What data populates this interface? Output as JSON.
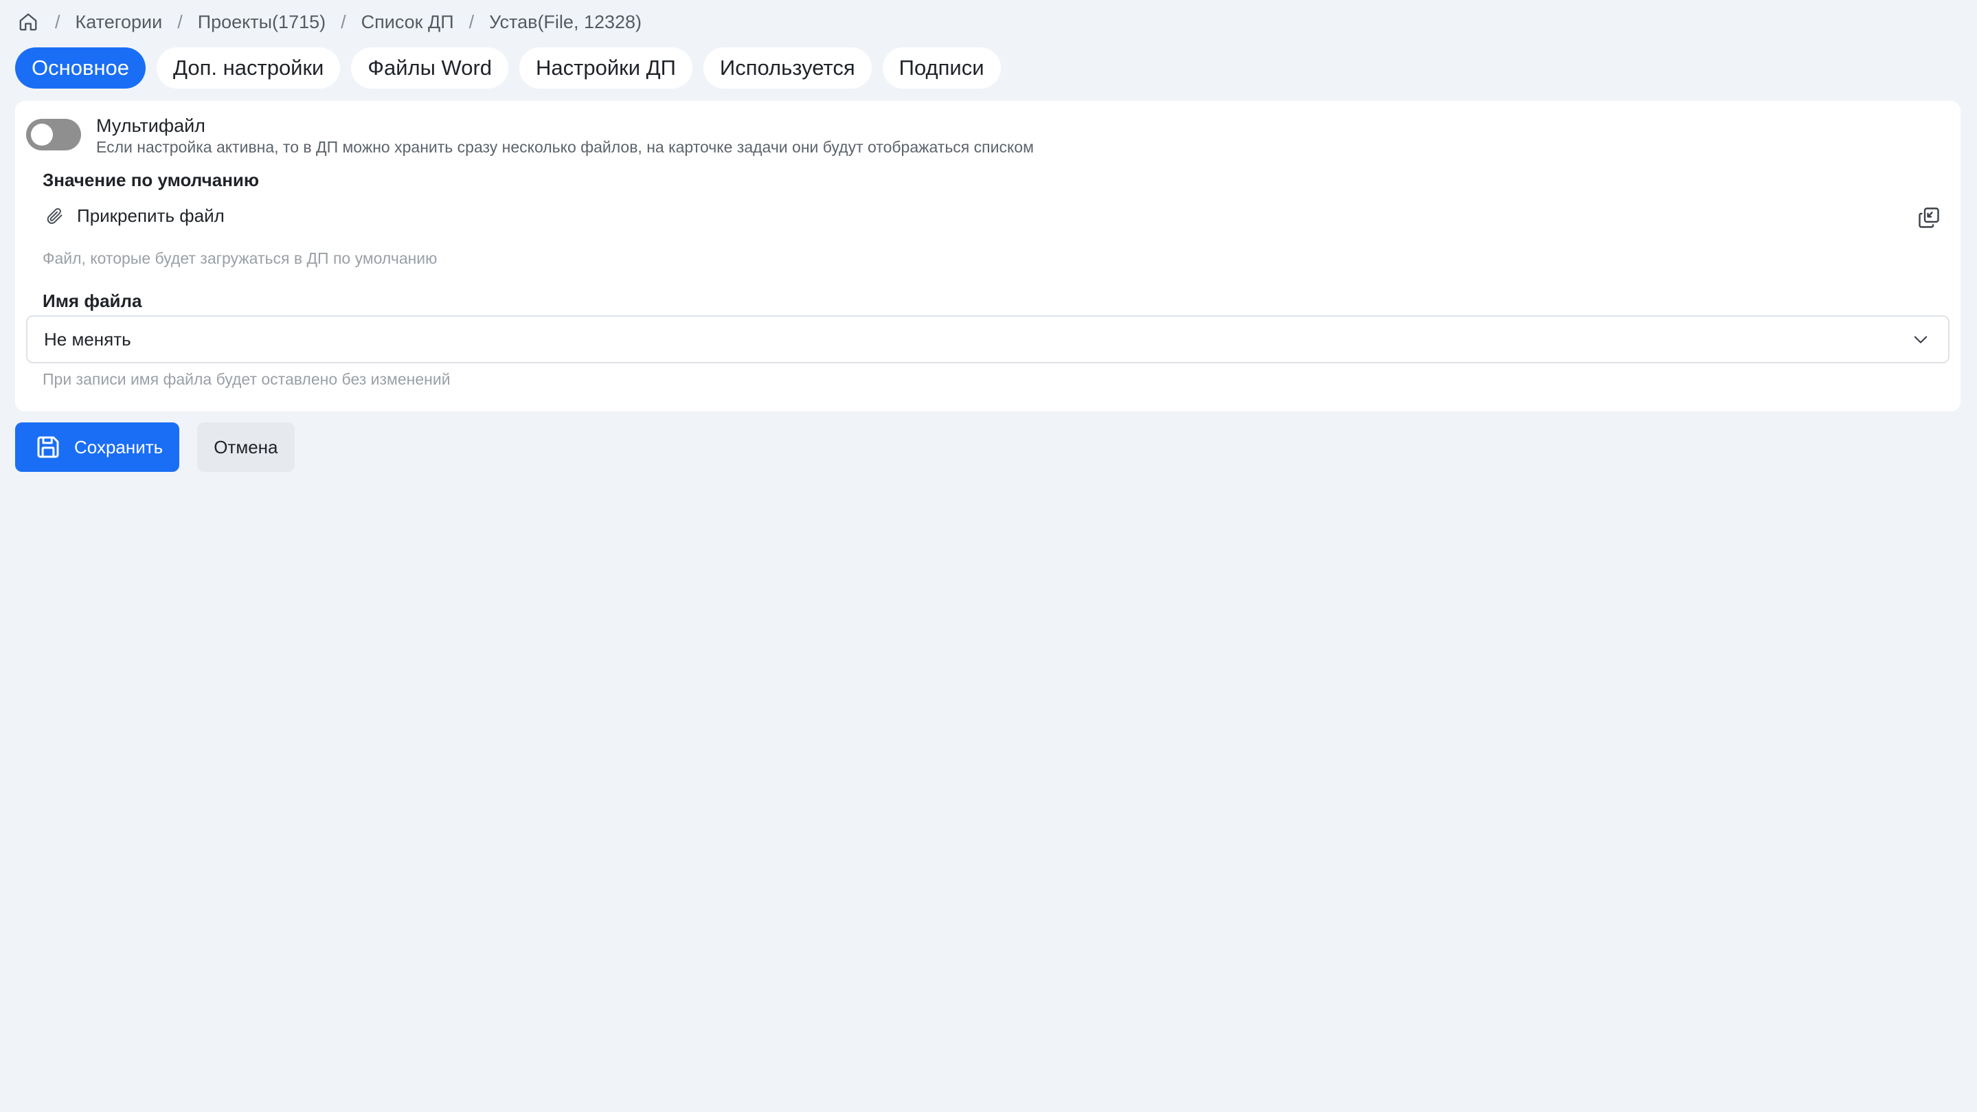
{
  "breadcrumb": {
    "home_icon": "home-icon",
    "items": [
      "Категории",
      "Проекты(1715)",
      "Список ДП",
      "Устав(File, 12328)"
    ],
    "separator": "/"
  },
  "tabs": [
    {
      "label": "Основное",
      "active": true
    },
    {
      "label": "Доп. настройки",
      "active": false
    },
    {
      "label": "Файлы Word",
      "active": false
    },
    {
      "label": "Настройки ДП",
      "active": false
    },
    {
      "label": "Используется",
      "active": false
    },
    {
      "label": "Подписи",
      "active": false
    }
  ],
  "multifile": {
    "title": "Мультифайл",
    "description": "Если настройка активна, то в ДП можно хранить сразу несколько файлов, на карточке задачи они будут отображаться списком",
    "enabled": false
  },
  "default_value": {
    "label": "Значение по умолчанию",
    "attach_label": "Прикрепить файл",
    "hint": "Файл, которые будет загружаться в ДП по умолчанию"
  },
  "file_name": {
    "label": "Имя файла",
    "value": "Не менять",
    "hint": "При записи имя файла будет оставлено без изменений"
  },
  "actions": {
    "save_label": "Сохранить",
    "cancel_label": "Отмена"
  },
  "colors": {
    "accent": "#1a6ef5",
    "background": "#f0f4f8",
    "toggle_off": "#8f8f8f"
  }
}
